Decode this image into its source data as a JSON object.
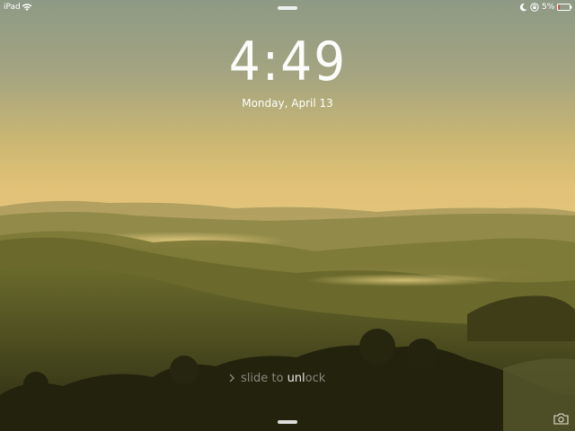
{
  "status_bar": {
    "carrier": "iPad",
    "battery_percent": "5%",
    "icons": [
      "wifi-icon",
      "moon-icon",
      "rotation-lock-icon",
      "battery-icon"
    ],
    "battery_color": "#e8312a"
  },
  "lock_screen": {
    "time": "4:49",
    "date": "Monday, April 13",
    "slide_prefix": "slide to ",
    "slide_emphasis": "unl",
    "slide_suffix": "ock",
    "camera_icon": "camera-icon",
    "chevron_icon": "chevron-right-icon"
  },
  "wallpaper": {
    "description_icon": "landscape-wallpaper"
  }
}
